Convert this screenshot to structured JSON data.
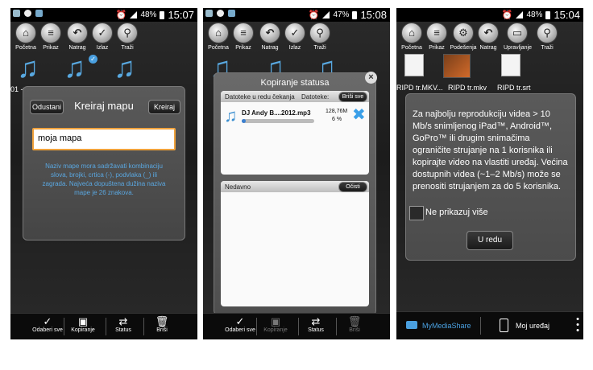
{
  "status_bars": [
    {
      "time": "15:07",
      "battery": "48%"
    },
    {
      "time": "15:08",
      "battery": "47%"
    },
    {
      "time": "15:04",
      "battery": "48%"
    }
  ],
  "screen1": {
    "toolbar": [
      "Početna",
      "Prikaz",
      "Natrag",
      "Izlaz",
      "Traži"
    ],
    "file_label": "01 -v",
    "dialog": {
      "cancel": "Odustani",
      "title": "Kreiraj mapu",
      "create": "Kreiraj",
      "input_value": "moja mapa",
      "hint": "Naziv mape mora sadržavati kombinaciju slova, brojki, crtica (-), podvlaka (_) ili zagrada. Najveća dopuštena dužina naziva mape je 26 znakova."
    },
    "bottom": [
      "Odaberi sve",
      "Kopiranje",
      "Status",
      "Briši"
    ]
  },
  "screen2": {
    "toolbar": [
      "Početna",
      "Prikaz",
      "Natrag",
      "Izlaz",
      "Traži"
    ],
    "dialog": {
      "title": "Kopiranje statusa",
      "queue_label": "Datoteke u redu čekanja",
      "files_label": "Datoteke:",
      "delete_all": "Briši sve",
      "file_name": "DJ Andy B....2012.mp3",
      "file_size": "128,76M",
      "progress_text": "6 %",
      "progress": 0.06,
      "recent_label": "Nedavno",
      "clear": "Očisti"
    },
    "bottom": [
      "Odaberi sve",
      "Kopiranje",
      "Status",
      "Briši"
    ]
  },
  "screen3": {
    "toolbar": [
      "Početna",
      "Prikaz",
      "Podešenja",
      "Natrag",
      "Upravljanje",
      "Traži"
    ],
    "files": [
      "RIPD tr.MKV...",
      "RIPD tr.mkv",
      "RIPD tr.srt"
    ],
    "dialog": {
      "message": "Za najbolju reprodukciju videa > 10 Mb/s snimljenog iPad™, Android™, GoPro™ ili drugim snimačima ograničite strujanje na 1 korisnika ili kopirajte video na vlastiti uređaj. Većina dostupnih videa (~1–2 Mb/s) može se prenositi strujanjem za do 5 korisnika.",
      "checkbox_label": "Ne prikazuj više",
      "ok": "U redu"
    },
    "bottom": [
      "MyMediaShare",
      "Moj uređaj"
    ]
  }
}
